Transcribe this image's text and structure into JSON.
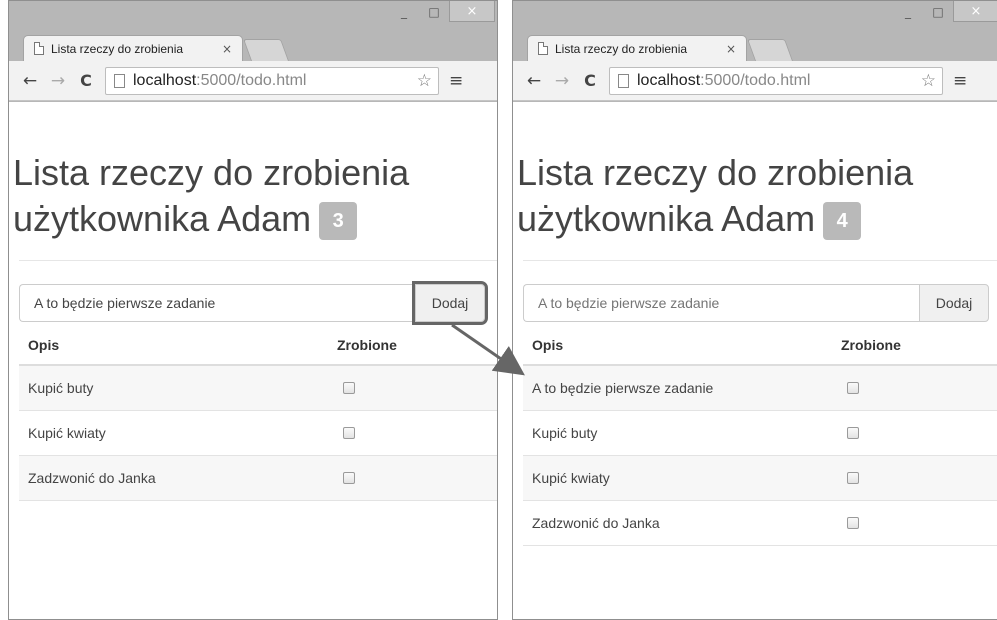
{
  "windows": [
    {
      "tab_title": "Lista rzeczy do zrobienia",
      "tab_close": "×",
      "url_host": "localhost",
      "url_rest": ":5000/todo.html",
      "heading_line1": "Lista rzeczy do zrobienia",
      "heading_line2": "użytkownika Adam",
      "count": "3",
      "input_value": "A to będzie pierwsze zadanie",
      "add_label": "Dodaj",
      "col_desc": "Opis",
      "col_done": "Zrobione",
      "items": [
        "Kupić buty",
        "Kupić kwiaty",
        "Zadzwonić do Janka"
      ]
    },
    {
      "tab_title": "Lista rzeczy do zrobienia",
      "tab_close": "×",
      "url_host": "localhost",
      "url_rest": ":5000/todo.html",
      "heading_line1": "Lista rzeczy do zrobienia",
      "heading_line2": "użytkownika Adam",
      "count": "4",
      "input_placeholder": "A to będzie pierwsze zadanie",
      "add_label": "Dodaj",
      "col_desc": "Opis",
      "col_done": "Zrobione",
      "items": [
        "A to będzie pierwsze zadanie",
        "Kupić buty",
        "Kupić kwiaty",
        "Zadzwonić do Janka"
      ]
    }
  ],
  "icons": {
    "minimize": "_",
    "maximize": "□",
    "close": "×",
    "back": "←",
    "forward": "→",
    "reload": "C",
    "star": "☆",
    "menu": "≡"
  },
  "colors": {
    "highlight_box": "#666666",
    "badge": "#b9b9b9",
    "arrow": "#666666"
  }
}
